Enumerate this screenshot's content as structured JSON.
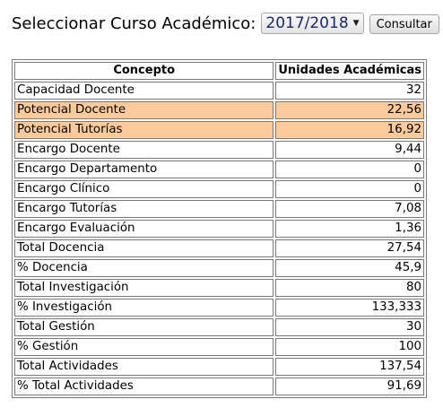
{
  "selector": {
    "label": "Seleccionar Curso Académico:",
    "selected_year": "2017/2018",
    "button_label": "Consultar"
  },
  "table": {
    "headers": [
      "Concepto",
      "Unidades Académicas"
    ],
    "rows": [
      {
        "concept": "Capacidad Docente",
        "units": "32",
        "highlighted": false
      },
      {
        "concept": "Potencial Docente",
        "units": "22,56",
        "highlighted": true
      },
      {
        "concept": "Potencial Tutorías",
        "units": "16,92",
        "highlighted": true
      },
      {
        "concept": "Encargo Docente",
        "units": "9,44",
        "highlighted": false
      },
      {
        "concept": "Encargo Departamento",
        "units": "0",
        "highlighted": false
      },
      {
        "concept": "Encargo Clínico",
        "units": "0",
        "highlighted": false
      },
      {
        "concept": "Encargo Tutorías",
        "units": "7,08",
        "highlighted": false
      },
      {
        "concept": "Encargo Evaluación",
        "units": "1,36",
        "highlighted": false
      },
      {
        "concept": "Total Docencia",
        "units": "27,54",
        "highlighted": false
      },
      {
        "concept": "% Docencia",
        "units": "45,9",
        "highlighted": false
      },
      {
        "concept": "Total Investigación",
        "units": "80",
        "highlighted": false
      },
      {
        "concept": "% Investigación",
        "units": "133,333",
        "highlighted": false
      },
      {
        "concept": "Total Gestión",
        "units": "30",
        "highlighted": false
      },
      {
        "concept": "% Gestión",
        "units": "100",
        "highlighted": false
      },
      {
        "concept": "Total Actividades",
        "units": "137,54",
        "highlighted": false
      },
      {
        "concept": "% Total Actividades",
        "units": "91,69",
        "highlighted": false
      }
    ]
  },
  "colors": {
    "highlight_row": "#fdca9b",
    "border": "#7a7a7a",
    "select_text": "#1a2a6c"
  }
}
